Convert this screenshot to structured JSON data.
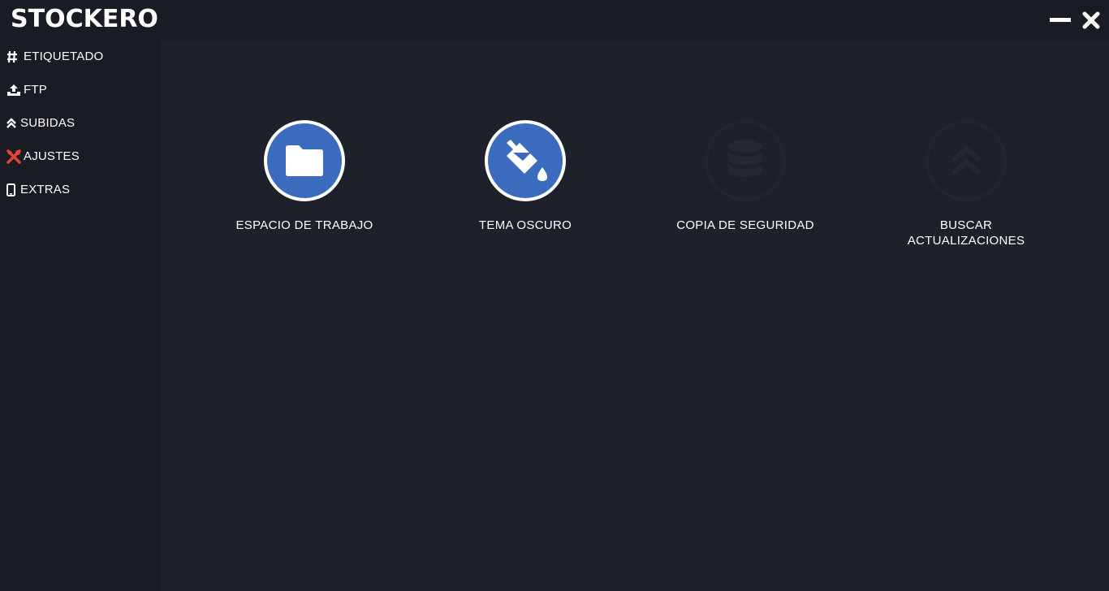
{
  "app": {
    "title": "STOCKERO",
    "minimize_icon": "minimize-icon",
    "close_icon": "close-icon"
  },
  "sidebar": {
    "items": [
      {
        "label": "ETIQUETADO",
        "icon": "hash-icon",
        "icon_color": "#ffffff"
      },
      {
        "label": "FTP",
        "icon": "upload-icon",
        "icon_color": "#ffffff"
      },
      {
        "label": "SUBIDAS",
        "icon": "chevrons-up-icon",
        "icon_color": "#ffffff"
      },
      {
        "label": "AJUSTES",
        "icon": "tools-icon",
        "icon_color": "#e0453a"
      },
      {
        "label": "EXTRAS",
        "icon": "mobile-icon",
        "icon_color": "#ffffff"
      }
    ]
  },
  "settings": {
    "options": [
      {
        "label": "ESPACIO DE TRABAJO",
        "icon": "folder-icon",
        "state": "enabled"
      },
      {
        "label": "TEMA OSCURO",
        "icon": "paint-bucket-icon",
        "state": "enabled"
      },
      {
        "label": "COPIA DE SEGURIDAD",
        "icon": "database-icon",
        "state": "disabled"
      },
      {
        "label": "BUSCAR\nACTUALIZACIONES",
        "icon": "chevrons-up-icon",
        "state": "disabled"
      }
    ]
  },
  "colors": {
    "accent": "#3a6bbd",
    "titlebar": "#191b25",
    "background": "#1e202b",
    "danger": "#e0453a"
  }
}
